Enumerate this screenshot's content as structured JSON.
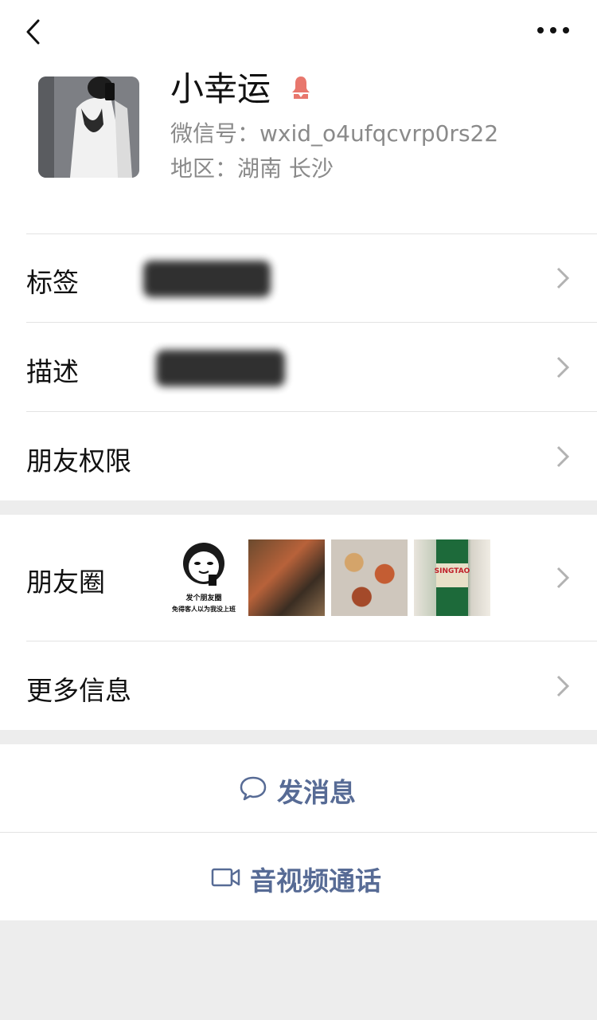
{
  "profile": {
    "name": "小幸运",
    "wechat_id_label": "微信号：",
    "wechat_id": "wxid_o4ufqcvrp0rs22",
    "region_label": "地区：",
    "region": "湖南 长沙"
  },
  "rows": {
    "tags": "标签",
    "description": "描述",
    "friend_permissions": "朋友权限",
    "moments": "朋友圈",
    "more_info": "更多信息"
  },
  "moments_meme": {
    "line1": "发个朋友圈",
    "line2": "免得客人以为我没上班"
  },
  "moments_beer_text": "SINGTAO",
  "actions": {
    "send_message": "发消息",
    "video_call": "音视频通话"
  },
  "colors": {
    "link": "#576b95",
    "gender_female": "#e8776d",
    "background": "#ededed"
  }
}
